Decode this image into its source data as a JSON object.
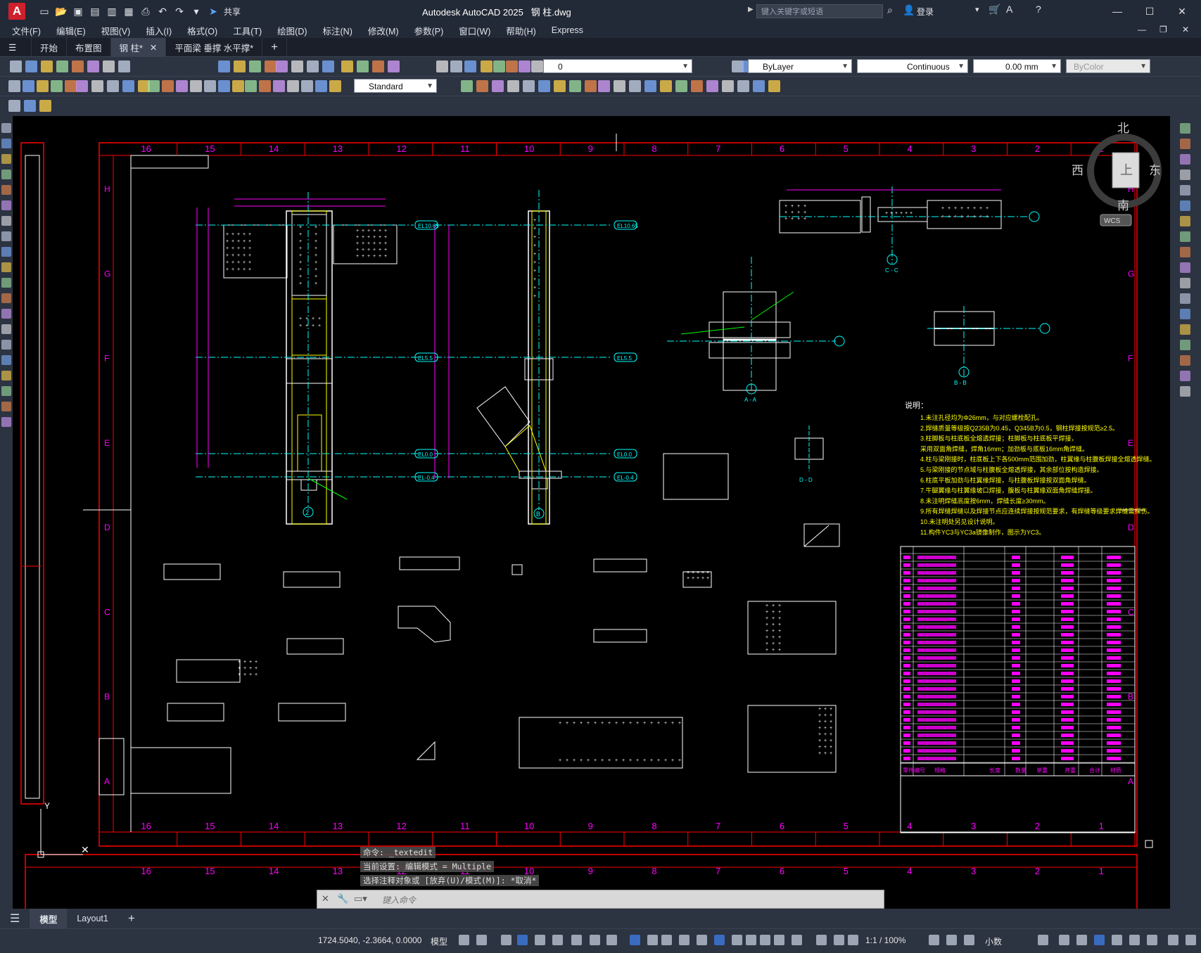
{
  "title": {
    "app": "Autodesk AutoCAD 2025",
    "file": "钢 柱.dwg",
    "share": "共享",
    "search_placeholder": "键入关键字或短语",
    "login": "登录"
  },
  "menu": [
    "文件(F)",
    "编辑(E)",
    "视图(V)",
    "插入(I)",
    "格式(O)",
    "工具(T)",
    "绘图(D)",
    "标注(N)",
    "修改(M)",
    "参数(P)",
    "窗口(W)",
    "帮助(H)",
    "Express"
  ],
  "tabs": [
    {
      "label": "开始"
    },
    {
      "label": "布置图"
    },
    {
      "label": "钢 柱*",
      "active": true
    },
    {
      "label": "平面梁 垂撑 水平撑*"
    }
  ],
  "properties": {
    "layer": "0",
    "color": "ByLayer",
    "linetype": "Continuous",
    "lineweight": "0.00 mm",
    "plotstyle": "ByColor",
    "text_style": "Standard"
  },
  "viewcube": {
    "north": "北",
    "south": "南",
    "east": "东",
    "west": "西",
    "top": "上",
    "wcs": "WCS"
  },
  "frame": {
    "top_numbers": [
      "16",
      "15",
      "14",
      "13",
      "12",
      "11",
      "10",
      "9",
      "8",
      "7",
      "6",
      "5",
      "4",
      "3",
      "2",
      "1"
    ],
    "side_letters": [
      "H",
      "G",
      "F",
      "E",
      "D",
      "C",
      "B",
      "A"
    ]
  },
  "drawing": {
    "elevations": [
      "EL10.65",
      "EL5.5",
      "EL0.0",
      "EL-0.4"
    ],
    "section_labels": [
      "C - C",
      "A - A",
      "B - B",
      "D - D"
    ],
    "notes_title": "说明：",
    "notes": [
      "1.未注孔径均为Φ26mm，与对应螺栓配孔。",
      "2.焊缝质量等级按Q235B为0.45，Q345B为0.5，钢柱焊接按规范≥2.5。",
      "3.柱脚板与柱底板全熔透焊接；柱脚板与柱底板平焊接，",
      "  采用双面角焊缝，焊角16mm；加劲板与底板16mm角焊缝。",
      "4.柱与梁刚接时，柱底板上下各500mm范围加劲，柱翼缘与柱腹板焊接全熔透焊缝。",
      "5.与梁刚接的节点域与柱腹板全熔透焊接，其余部位按构造焊接。",
      "6.柱底平板加劲与柱翼缘焊接，与柱腹板焊接按双面角焊缝。",
      "7.牛腿翼缘与柱翼缘坡口焊接，腹板与柱翼缘双面角焊缝焊接。",
      "8.未注明焊缝高度按6mm，焊缝长度≥30mm。",
      "9.所有焊缝焊缝以及焊接节点应连续焊接按规范要求，有焊缝等级要求焊缝需探伤。",
      "10.未注明处另见设计说明。",
      "11.构件YC3与YC3a镜像制作，图示为YC3。"
    ],
    "table_footer": [
      "零件编号",
      "规格",
      "长度",
      "数量",
      "单重",
      "共重",
      "合计",
      "材质"
    ]
  },
  "command_log": [
    "命令: _textedit",
    "当前设置: 编辑模式 = Multiple",
    "选择注释对象或 [放弃(U)/模式(M)]: *取消*"
  ],
  "command_placeholder": "键入命令",
  "layouts": [
    {
      "label": "模型",
      "active": true
    },
    {
      "label": "Layout1"
    }
  ],
  "status": {
    "coords": "1724.5040, -2.3664, 0.0000",
    "mode": "模型",
    "scale": "1:1 / 100%",
    "units": "小数"
  },
  "colors": {
    "canvas": "#000000",
    "frame": "#ff0000",
    "dim": "#ff00ff",
    "beam": "#ffff00",
    "axis": "#00ffff",
    "ui_bg": "#2c3341"
  }
}
